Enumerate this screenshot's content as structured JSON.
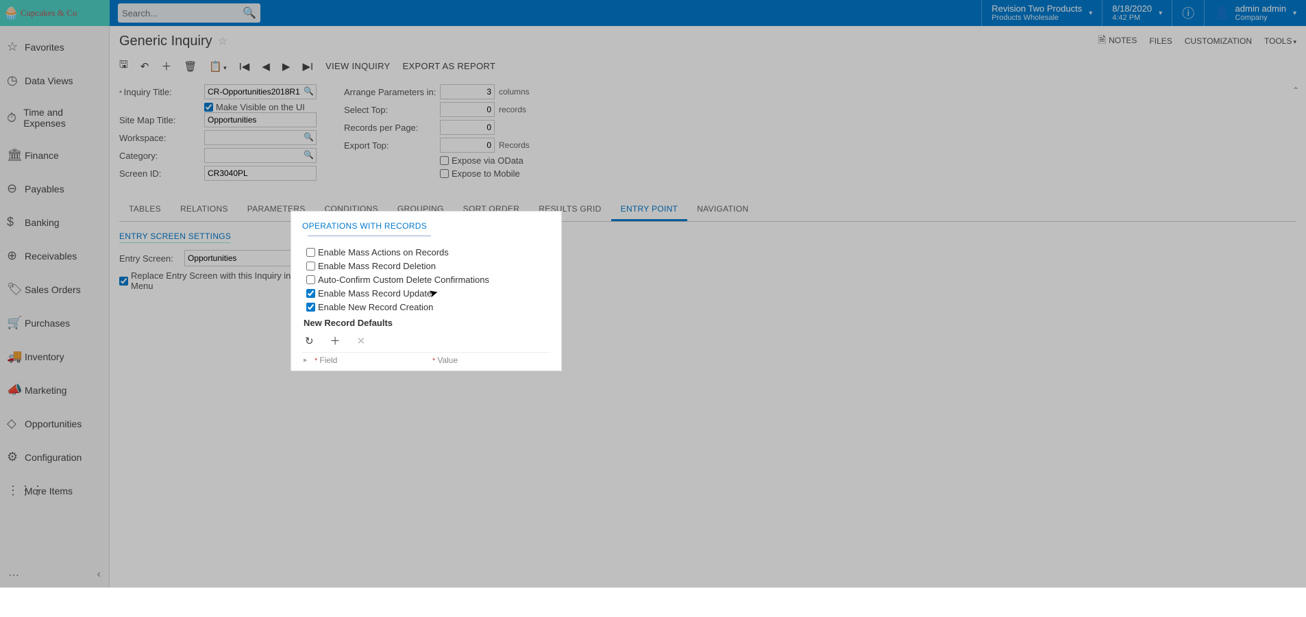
{
  "logo": "Cupcakes & Co",
  "search_placeholder": "Search...",
  "header": {
    "tenant": "Revision Two Products",
    "tenant_sub": "Products Wholesale",
    "date": "8/18/2020",
    "time": "4:42 PM",
    "user": "admin admin",
    "user_sub": "Company"
  },
  "sidebar": {
    "items": [
      {
        "icon": "☆",
        "label": "Favorites"
      },
      {
        "icon": "◷",
        "label": "Data Views"
      },
      {
        "icon": "⏱",
        "label": "Time and Expenses"
      },
      {
        "icon": "🏛",
        "label": "Finance"
      },
      {
        "icon": "⊖",
        "label": "Payables"
      },
      {
        "icon": "$",
        "label": "Banking"
      },
      {
        "icon": "⊕",
        "label": "Receivables"
      },
      {
        "icon": "🏷",
        "label": "Sales Orders"
      },
      {
        "icon": "🛒",
        "label": "Purchases"
      },
      {
        "icon": "🚚",
        "label": "Inventory"
      },
      {
        "icon": "📣",
        "label": "Marketing"
      },
      {
        "icon": "◇",
        "label": "Opportunities"
      },
      {
        "icon": "⚙",
        "label": "Configuration"
      },
      {
        "icon": "⋮⋮⋮",
        "label": "More Items"
      }
    ]
  },
  "page": {
    "title": "Generic Inquiry",
    "tools": {
      "notes": "NOTES",
      "files": "FILES",
      "custom": "CUSTOMIZATION",
      "tools": "TOOLS"
    }
  },
  "toolbar": {
    "view_inquiry": "VIEW INQUIRY",
    "export_report": "EXPORT AS REPORT"
  },
  "form": {
    "inquiry_title_label": "Inquiry Title:",
    "inquiry_title_value": "CR-Opportunities2018R1",
    "make_visible": "Make Visible on the UI",
    "site_map_label": "Site Map Title:",
    "site_map_value": "Opportunities",
    "workspace_label": "Workspace:",
    "category_label": "Category:",
    "screen_id_label": "Screen ID:",
    "screen_id_value": "CR3040PL",
    "arrange_label": "Arrange Parameters in:",
    "arrange_value": "3",
    "arrange_unit": "columns",
    "select_top_label": "Select Top:",
    "select_top_value": "0",
    "select_top_unit": "records",
    "records_page_label": "Records per Page:",
    "records_page_value": "0",
    "export_top_label": "Export Top:",
    "export_top_value": "0",
    "export_top_unit": "Records",
    "expose_odata": "Expose via OData",
    "expose_mobile": "Expose to Mobile"
  },
  "tabs": [
    "TABLES",
    "RELATIONS",
    "PARAMETERS",
    "CONDITIONS",
    "GROUPING",
    "SORT ORDER",
    "RESULTS GRID",
    "ENTRY POINT",
    "NAVIGATION"
  ],
  "active_tab": "ENTRY POINT",
  "entry": {
    "section": "ENTRY SCREEN SETTINGS",
    "entry_screen_label": "Entry Screen:",
    "entry_screen_value": "Opportunities",
    "replace": "Replace Entry Screen with this Inquiry in Menu"
  },
  "ops": {
    "section": "OPERATIONS WITH RECORDS",
    "c1": "Enable Mass Actions on Records",
    "c2": "Enable Mass Record Deletion",
    "c3": "Auto-Confirm Custom Delete Confirmations",
    "c4": "Enable Mass Record Update",
    "c5": "Enable New Record Creation",
    "sub": "New Record Defaults",
    "col_field": "Field",
    "col_value": "Value"
  }
}
